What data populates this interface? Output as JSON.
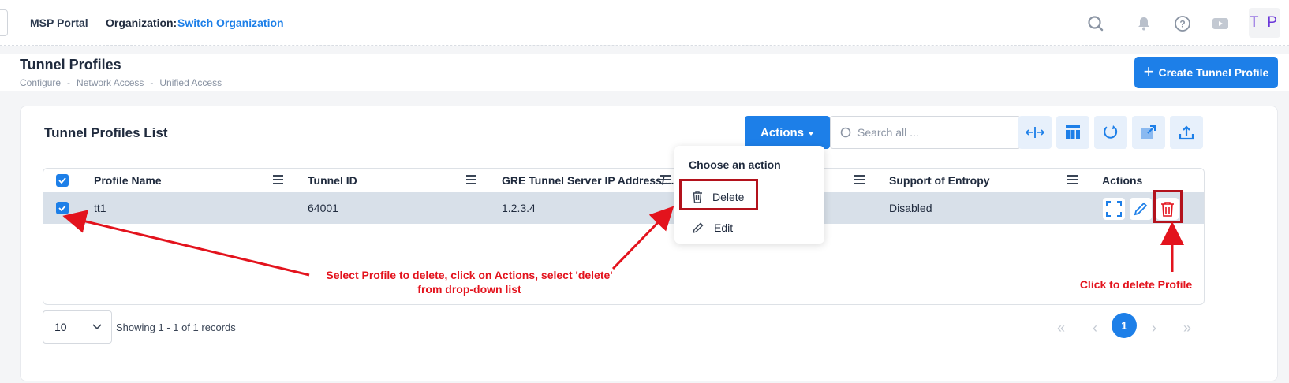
{
  "topbar": {
    "brand": "MSP Portal",
    "org_label": "Organization:",
    "org_link": "Switch Organization",
    "avatar": "T P"
  },
  "page": {
    "title": "Tunnel Profiles",
    "breadcrumb": [
      "Configure",
      "Network Access",
      "Unified Access"
    ],
    "breadcrumb_sep": "-",
    "create_label": "Create Tunnel Profile"
  },
  "card": {
    "title": "Tunnel Profiles List",
    "actions_label": "Actions",
    "search_placeholder": "Search all ...",
    "columns": [
      "Profile Name",
      "Tunnel ID",
      "GRE Tunnel Server IP Address/...",
      "Support of Entropy",
      "Actions"
    ],
    "rows": [
      {
        "profile_name": "tt1",
        "tunnel_id": "64001",
        "gre_ip": "1.2.3.4",
        "entropy": "Disabled",
        "selected": true
      }
    ],
    "page_size": "10",
    "showing": "Showing 1 - 1 of 1 records",
    "current_page": "1"
  },
  "dropdown": {
    "title": "Choose an action",
    "items": [
      "Delete",
      "Edit"
    ]
  },
  "annotations": {
    "select_note": "Select Profile to delete, click on Actions, select 'delete' from drop-down list",
    "click_note": "Click to delete Profile"
  },
  "colors": {
    "primary": "#1d7fe8",
    "annotation_red": "#e3131d",
    "box_red": "#b3121c",
    "row_selected": "#d8e0e9"
  }
}
